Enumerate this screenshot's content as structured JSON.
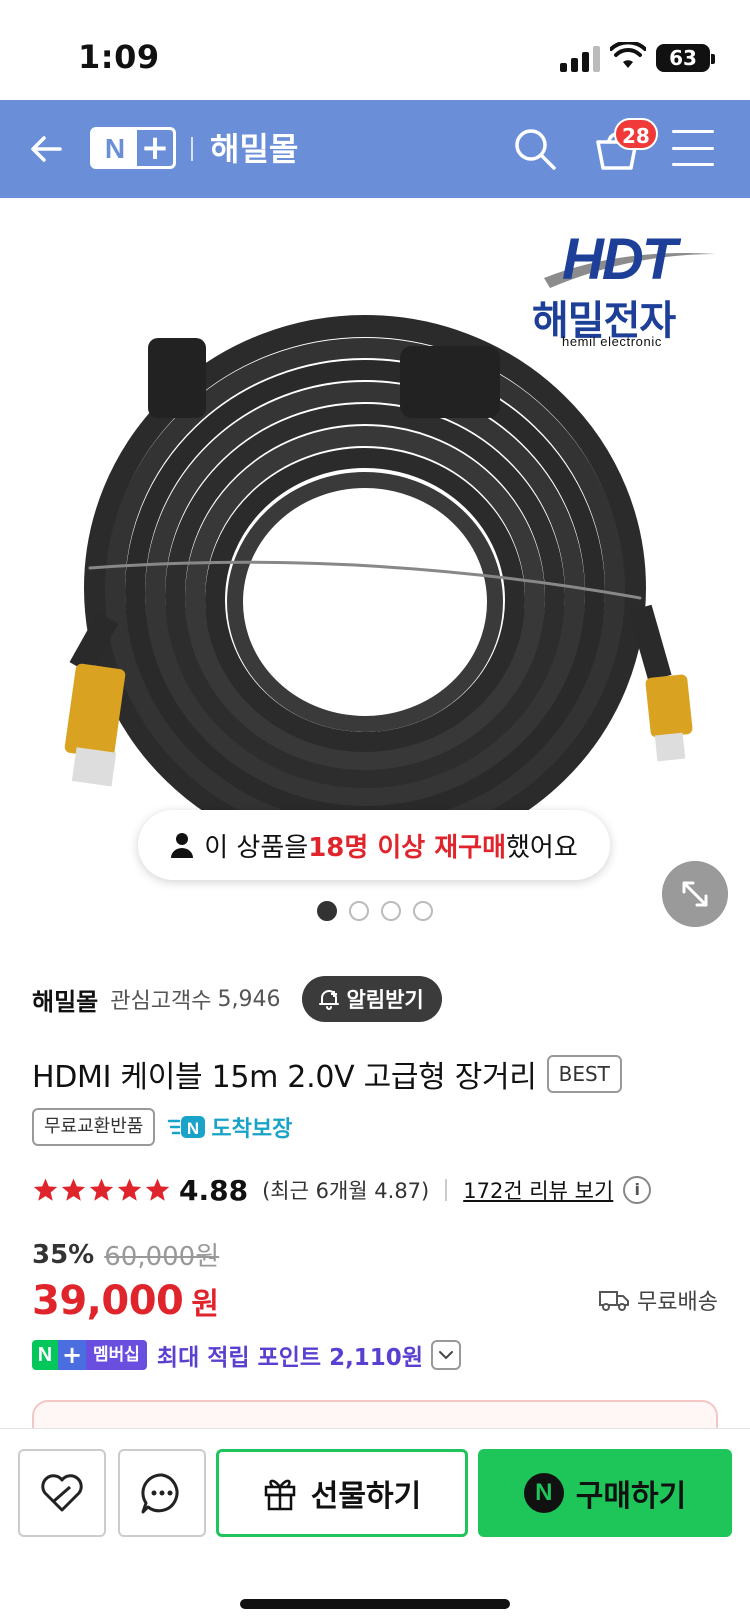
{
  "status_bar": {
    "time": "1:09",
    "battery": "63"
  },
  "header": {
    "logo_n": "N",
    "logo_plus": "+",
    "title": "해밀몰",
    "cart_count": "28",
    "background": "#6a8fd8"
  },
  "product_image": {
    "brand_mark": "HDT",
    "brand_name": "해밀전자",
    "brand_sub": "hemil electronic",
    "rebuy": {
      "pre": "이 상품을 ",
      "highlight": "18명 이상 재구매",
      "post": " 했어요"
    },
    "slides_total": 4,
    "slide_active": 1
  },
  "store": {
    "name": "해밀몰",
    "fav_label": "관심고객수",
    "fav_count": "5,946",
    "alarm_label": "알림받기"
  },
  "product": {
    "title": "HDMI 케이블 15m 2.0V 고급형 장거리",
    "best_badge": "BEST",
    "free_return": "무료교환반품",
    "arrival_label": "도착보장"
  },
  "rating": {
    "stars": 5,
    "score": "4.88",
    "recent": "(최근 6개월 4.87)",
    "review_link": "172건 리뷰 보기",
    "info_icon": "i"
  },
  "pricing": {
    "discount": "35%",
    "original": "60,000원",
    "price": "39,000",
    "currency": "원",
    "shipping": "무료배송"
  },
  "membership": {
    "n": "N",
    "plus": "+",
    "label": "멤버십",
    "points_text": "최대 적립 포인트 2,110원"
  },
  "bottom_bar": {
    "gift_label": "선물하기",
    "buy_n": "N",
    "buy_label": "구매하기",
    "accent": "#1ec65a"
  },
  "colors": {
    "price_red": "#e0242b",
    "point_purple": "#5a3fd1"
  }
}
